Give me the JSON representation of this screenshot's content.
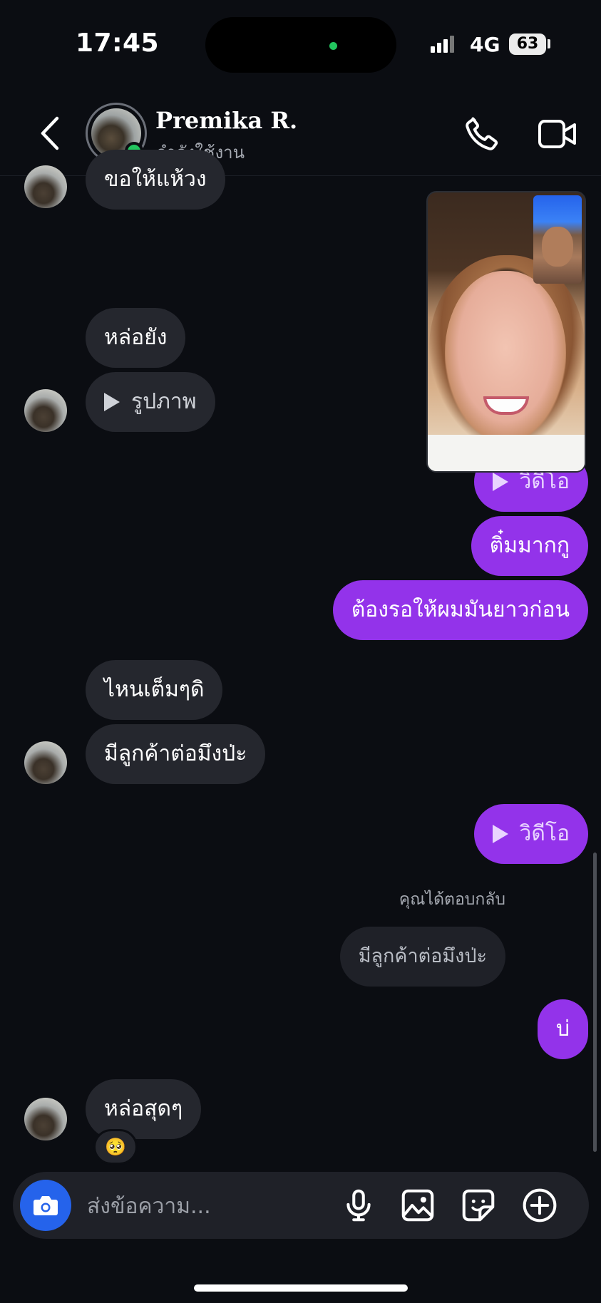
{
  "status_bar": {
    "time": "17:45",
    "network": "4G",
    "battery": "63"
  },
  "header": {
    "contact_name": "Premika R.",
    "contact_status": "กำลังใช้งาน"
  },
  "messages": {
    "m0": "ขอให้แห้วง",
    "m1": "หล่อยัง",
    "m2": "รูปภาพ",
    "m3": "วิดีโอ",
    "m4": "ติ๋มมากกู",
    "m5": "ต้องรอให้ผมมันยาวก่อน",
    "m6": "ไหนเต็มๆดิ",
    "m7": "มีลูกค้าต่อมึงป่ะ",
    "m8": "วิดีโอ",
    "reply_label": "คุณได้ตอบกลับ",
    "reply_quote": "มีลูกค้าต่อมึงป่ะ",
    "m9": "บ่",
    "m10": "หล่อสุดๆ",
    "reaction": "🥺"
  },
  "composer": {
    "placeholder": "ส่งข้อความ..."
  },
  "icons": {
    "back": "chevron-left-icon",
    "call": "phone-icon",
    "video": "video-camera-icon",
    "camera": "camera-icon",
    "mic": "microphone-icon",
    "gallery": "image-icon",
    "sticker": "sticker-icon",
    "more": "plus-circle-icon"
  },
  "colors": {
    "outgoing": "#9333ea",
    "incoming": "#25272e",
    "online": "#22c55e",
    "camera_button": "#2563eb"
  }
}
